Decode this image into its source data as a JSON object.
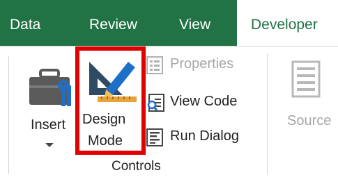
{
  "tabs": [
    {
      "id": "data",
      "label": "Data"
    },
    {
      "id": "review",
      "label": "Review"
    },
    {
      "id": "view",
      "label": "View"
    },
    {
      "id": "developer",
      "label": "Developer",
      "active": true
    }
  ],
  "ribbon": {
    "insert": {
      "label": "Insert",
      "icon": "toolbox-icon"
    },
    "design_mode": {
      "label_line1": "Design",
      "label_line2": "Mode",
      "icon": "design-mode-icon",
      "highlighted": true
    },
    "properties": {
      "label": "Properties",
      "enabled": false
    },
    "view_code": {
      "label": "View Code"
    },
    "run_dialog": {
      "label": "Run Dialog"
    },
    "source": {
      "label": "Source",
      "enabled": false
    },
    "group_label": "Controls"
  },
  "colors": {
    "tab_bar": "#217346",
    "highlight": "#e00000",
    "disabled_text": "#a6a6a6"
  }
}
